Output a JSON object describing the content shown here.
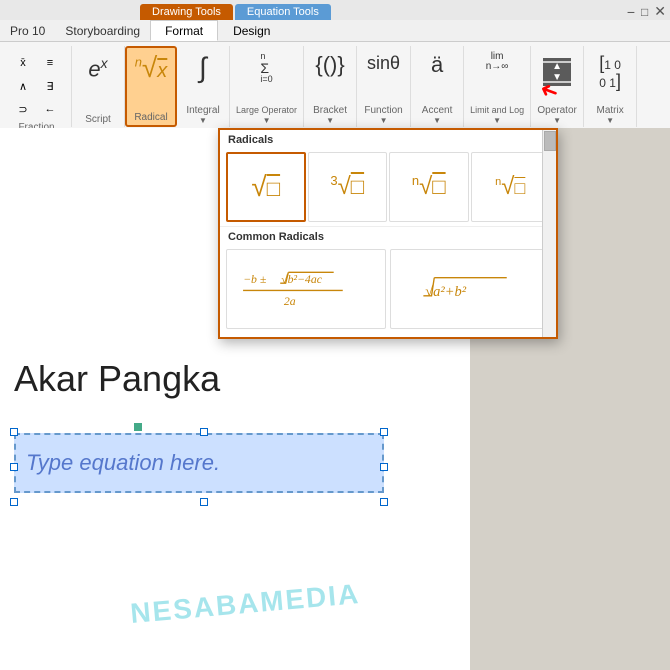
{
  "tabs": {
    "drawing_tools_label": "Drawing Tools",
    "equation_tools_label": "Equation Tools",
    "format_sub": "Format",
    "design_sub": "Design"
  },
  "app": {
    "pro_label": "Pro 10",
    "storyboarding": "Storyboarding"
  },
  "toolbar": {
    "groups": [
      {
        "name": "fraction_group",
        "label": "Fraction",
        "icon": "fraction"
      }
    ],
    "fraction_label": "Fraction",
    "script_label": "Script",
    "radical_label": "Radical",
    "integral_label": "Integral",
    "large_operator_label": "Large\nOperator",
    "bracket_label": "Bracket",
    "function_label": "Function",
    "accent_label": "Accent",
    "limit_and_log_label": "Limit and\nLog",
    "operator_label": "Operator",
    "matrix_label": "Matrix"
  },
  "radical_popup": {
    "title": "Radicals",
    "common_title": "Common Radicals",
    "items": [
      {
        "type": "sqrt",
        "display": "√□"
      },
      {
        "type": "cbrt",
        "display": "∛□"
      },
      {
        "type": "nthrt2",
        "display": "ⁿ√□"
      },
      {
        "type": "nthrt3",
        "display": "ⁿ√□"
      }
    ],
    "common_items": [
      {
        "formula": "quadratic"
      },
      {
        "formula": "pythagorean"
      }
    ]
  },
  "canvas": {
    "page_text": "Akar Pangka",
    "equation_placeholder": "Type equation here.",
    "watermark": "NESABAMEDIA"
  },
  "colors": {
    "drawing_tab_bg": "#c55a00",
    "equation_tab_bg": "#5b9bd5",
    "radical_highlight": "#ffd090",
    "accent": "#c55a00",
    "equation_box_bg": "#cce0ff",
    "equation_text": "#5577cc"
  }
}
